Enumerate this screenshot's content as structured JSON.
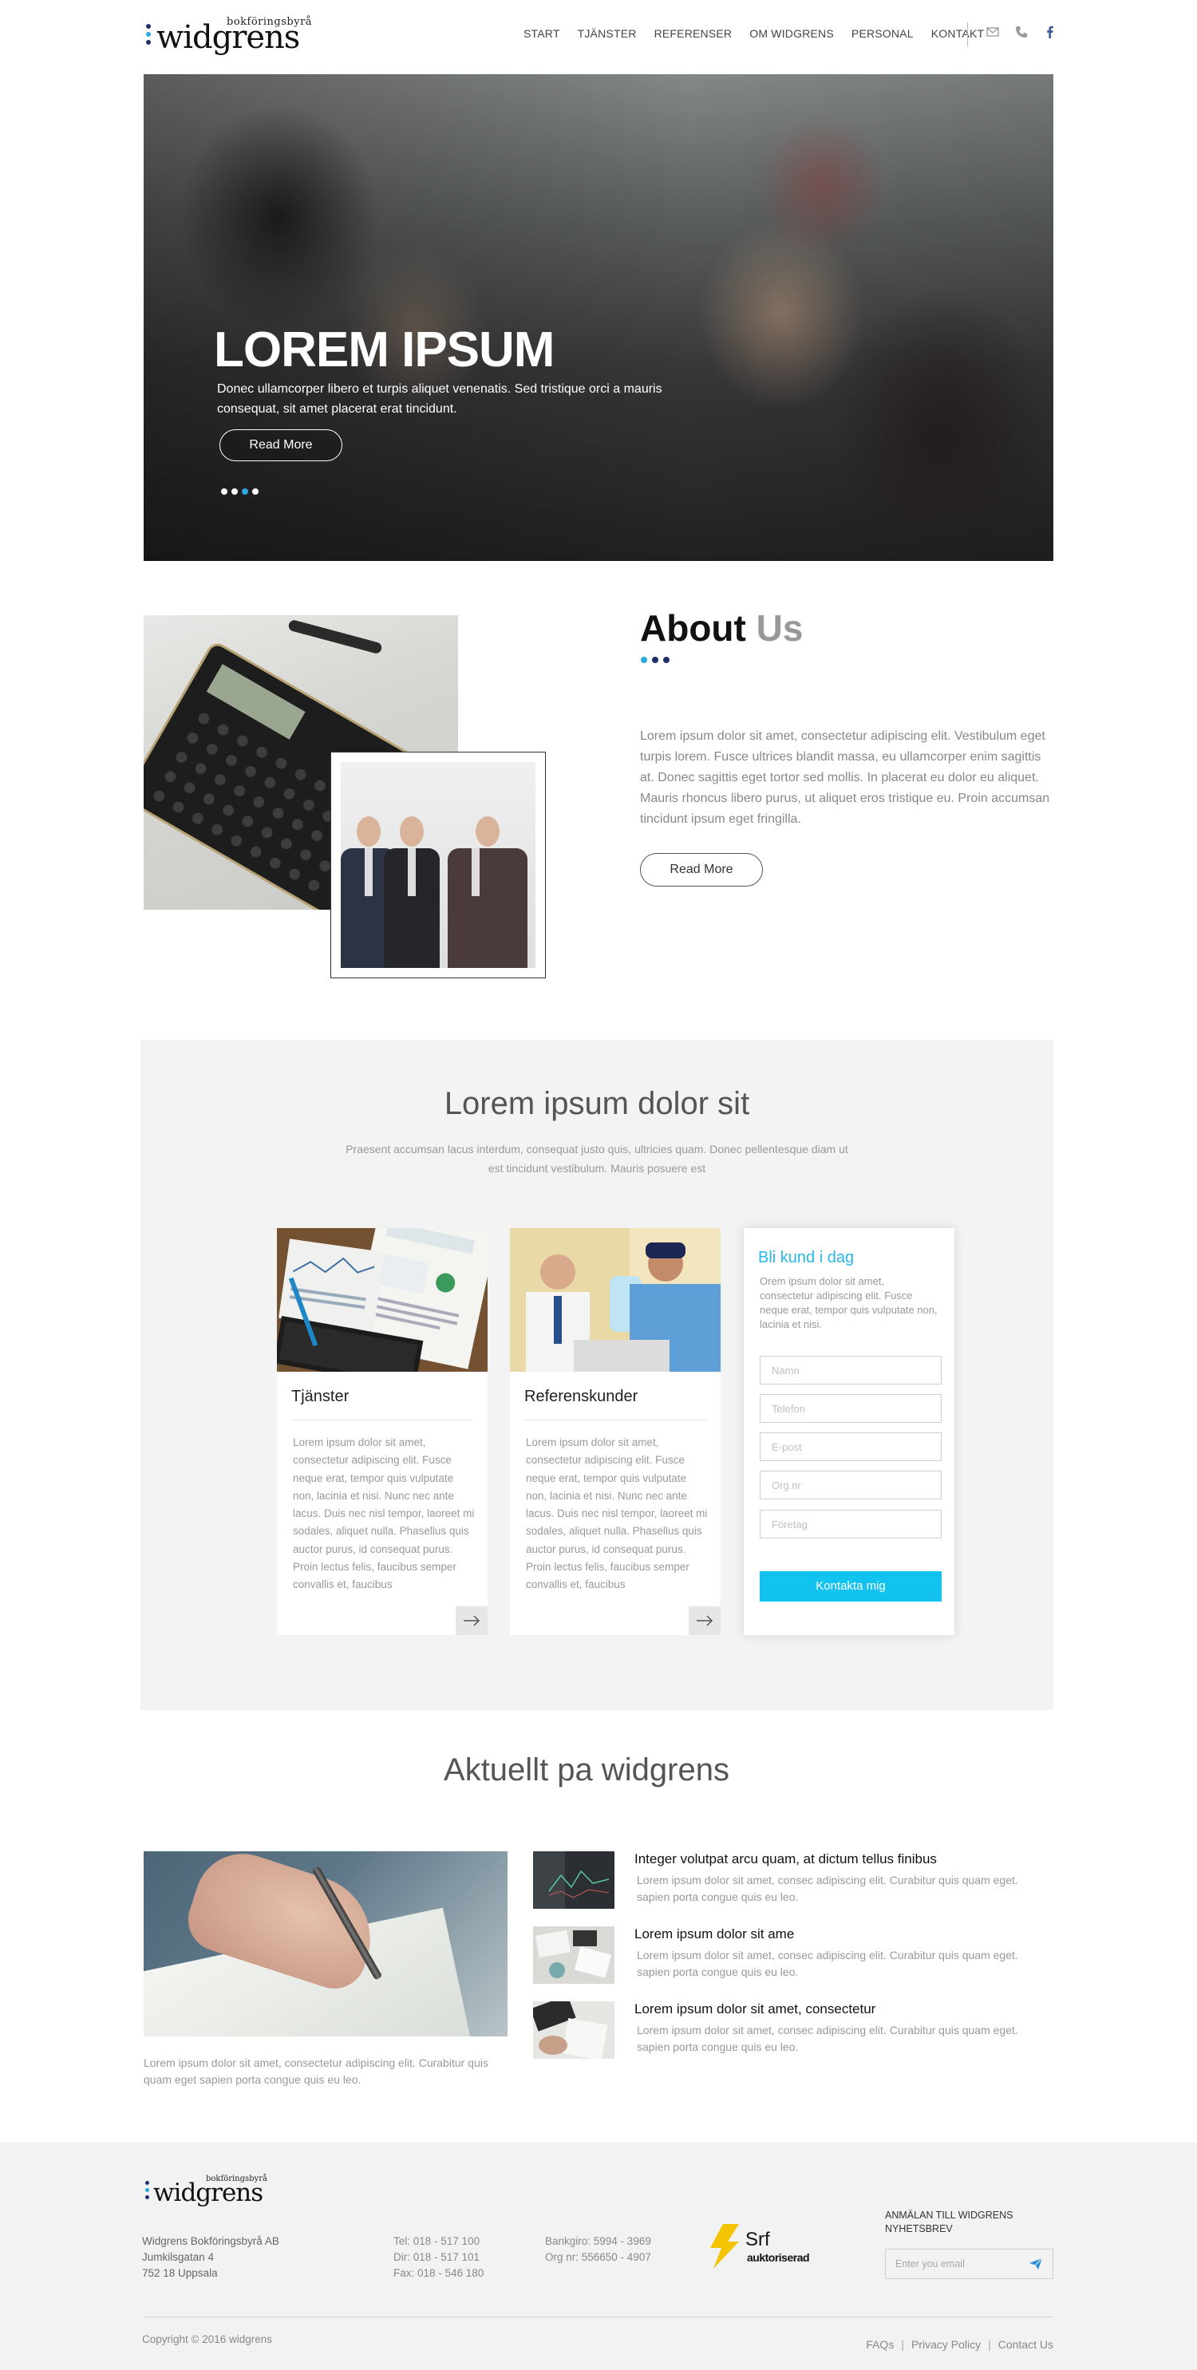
{
  "brand": {
    "logo_small": "bokföringsbyrå",
    "logo_main": "widgrens",
    "dot_colors": [
      "#1f2d6b",
      "#29a9e0",
      "#1f2d6b"
    ]
  },
  "nav": {
    "items": [
      "START",
      "TJÄNSTER",
      "REFERENSER",
      "OM WIDGRENS",
      "PERSONAL",
      "KONTAKT"
    ],
    "icons": [
      "mail-icon",
      "phone-icon",
      "facebook-icon"
    ]
  },
  "hero": {
    "title": "LOREM IPSUM",
    "text": "Donec ullamcorper libero et turpis aliquet venenatis. Sed tristique orci a mauris consequat, sit amet placerat erat tincidunt.",
    "button": "Read More",
    "slides": 4,
    "active_slide": 3
  },
  "about": {
    "title_dark": "About",
    "title_light": "Us",
    "dot_colors": [
      "#29a9e0",
      "#1f2d6b",
      "#1f2d6b"
    ],
    "text": "Lorem ipsum dolor sit amet, consectetur adipiscing elit. Vestibulum eget turpis lorem. Fusce ultrices blandit massa, eu ullamcorper enim sagittis at. Donec sagittis eget tortor sed mollis. In placerat eu dolor eu aliquet. Mauris rhoncus libero purus, ut aliquet eros tristique eu. Proin accumsan tincidunt ipsum eget fringilla.",
    "button": "Read More"
  },
  "services": {
    "title": "Lorem ipsum dolor sit",
    "subtitle": "Praesent accumsan lacus interdum, consequat justo quis, ultricies quam. Donec pellentesque diam ut est tincidunt vestibulum. Mauris posuere est",
    "cards": [
      {
        "title": "Tjänster",
        "text": "Lorem ipsum dolor sit amet, consectetur adipiscing elit. Fusce neque erat, tempor quis vulputate non, lacinia et nisi. Nunc nec ante lacus. Duis nec nisl tempor, laoreet mi sodales, aliquet nulla. Phasellus quis auctor purus, id consequat purus. Proin lectus felis, faucibus semper convallis et, faucibus"
      },
      {
        "title": "Referenskunder",
        "text": "Lorem ipsum dolor sit amet, consectetur adipiscing elit. Fusce neque erat, tempor quis vulputate non, lacinia et nisi. Nunc nec ante lacus. Duis nec nisl tempor, laoreet mi sodales, aliquet nulla. Phasellus quis auctor purus, id consequat purus. Proin lectus felis, faucibus semper convallis et, faucibus"
      }
    ],
    "form": {
      "title": "Bli kund i dag",
      "text": "Orem ipsum dolor sit amet, consectetur adipiscing elit. Fusce neque erat, tempor quis vulputate non, lacinia et nisi.",
      "fields": [
        "Namn",
        "Telefon",
        "E-post",
        "Org.nr",
        "Företag"
      ],
      "button": "Kontakta mig",
      "accent": "#12c3ef"
    }
  },
  "news": {
    "title": "Aktuellt pa widgrens",
    "main_caption": "Lorem ipsum dolor sit amet, consectetur adipiscing elit. Curabitur quis quam eget sapien porta congue quis eu leo.",
    "items": [
      {
        "title": "Integer volutpat arcu quam, at dictum tellus finibus",
        "text": "Lorem ipsum dolor sit amet, consec adipiscing elit. Curabitur quis quam eget. sapien porta congue quis eu leo."
      },
      {
        "title": "Lorem ipsum dolor sit ame",
        "text": "Lorem ipsum dolor sit amet, consec adipiscing elit. Curabitur quis quam eget. sapien porta congue quis eu leo."
      },
      {
        "title": "Lorem ipsum dolor sit amet, consectetur",
        "text": "Lorem ipsum dolor sit amet, consec adipiscing elit. Curabitur quis quam eget. sapien porta congue quis eu leo."
      }
    ]
  },
  "footer": {
    "address": [
      "Widgrens Bokföringsbyrå AB",
      "Jumkilsgatan 4",
      "752 18 Uppsala"
    ],
    "phones": [
      "Tel: 018 - 517 100",
      "Dir: 018 - 517 101",
      "Fax: 018 - 546 180"
    ],
    "bank": [
      "Bankgiro: 5994 - 3969",
      "Org nr: 556650 - 4907"
    ],
    "srf_main": "Srf",
    "srf_sub": "auktoriserad",
    "newsletter_title": "ANMÄLAN TILL WIDGRENS NYHETSBREV",
    "newsletter_placeholder": "Enter you email",
    "copyright": "Copyright © 2016 widgrens",
    "links": [
      "FAQs",
      "Privacy Policy",
      "Contact Us"
    ],
    "separator": "|"
  }
}
